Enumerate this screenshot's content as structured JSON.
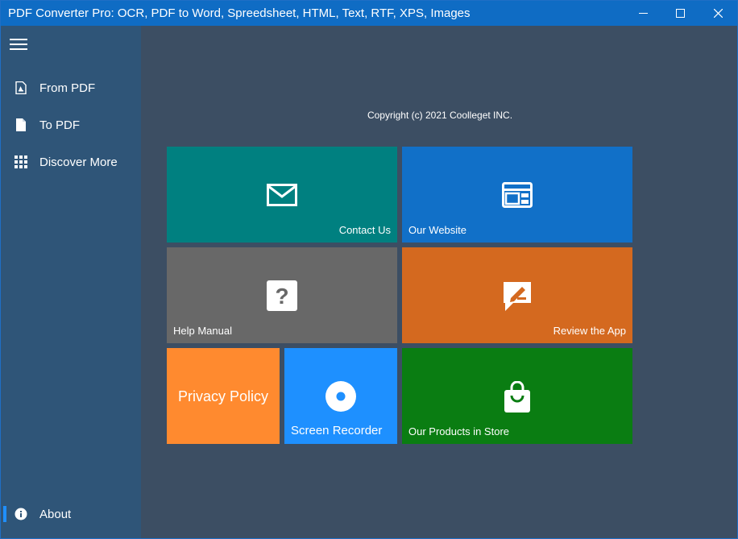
{
  "window": {
    "title": "PDF Converter Pro: OCR, PDF to Word, Spreedsheet, HTML, Text, RTF, XPS, Images",
    "controls": [
      "minimize",
      "maximize",
      "close"
    ]
  },
  "sidebar": {
    "menu_icon": "hamburger-icon",
    "items": [
      {
        "label": "From PDF",
        "icon": "pdf-file-icon"
      },
      {
        "label": "To PDF",
        "icon": "document-icon"
      },
      {
        "label": "Discover More",
        "icon": "grid-icon"
      }
    ],
    "footer": {
      "label": "About",
      "icon": "info-icon",
      "selected": true
    }
  },
  "main": {
    "copyright": "Copyright (c) 2021 Coolleget INC.",
    "tiles": [
      {
        "label": "Contact Us",
        "icon": "mail-icon",
        "color": "#008080"
      },
      {
        "label": "Our Website",
        "icon": "website-icon",
        "color": "#1170c8"
      },
      {
        "label": "Help Manual",
        "icon": "help-icon",
        "color": "#686868"
      },
      {
        "label": "Review the App",
        "icon": "review-icon",
        "color": "#d4691f"
      },
      {
        "label": "Privacy Policy",
        "icon": "",
        "color": "#ff8a2f"
      },
      {
        "label": "Screen Recorder",
        "icon": "record-icon",
        "color": "#1e90ff"
      },
      {
        "label": "Our Products in Store",
        "icon": "shopping-bag-icon",
        "color": "#0a7d12"
      }
    ]
  }
}
